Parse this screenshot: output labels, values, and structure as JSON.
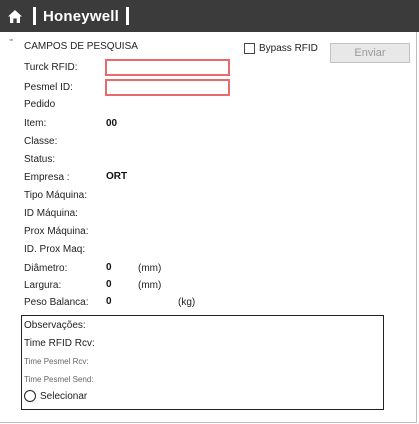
{
  "header": {
    "brand": "Honeywell",
    "home_icon": "home-icon"
  },
  "form": {
    "section_title": "CAMPOS DE PESQUISA",
    "bypass_label": "Bypass RFID",
    "bypass_checked": false,
    "send_label": "Enviar",
    "turck_label": "Turck RFID:",
    "turck_value": "",
    "pesmel_label": "Pesmel ID:",
    "pesmel_value": "",
    "pedido_label": "Pedido",
    "item_label": "Item:",
    "item_value": "00",
    "classe_label": "Classe:",
    "status_label": "Status:",
    "empresa_label": "Empresa :",
    "empresa_value": "ORT",
    "tipo_label": "Tipo Máquina:",
    "id_maquina_label": "ID Máquina:",
    "prox_maquina_label": "Prox Máquina:",
    "id_prox_label": "ID. Prox Maq:",
    "diametro_label": "Diâmetro:",
    "diametro_value": "0",
    "diametro_unit": "(mm)",
    "largura_label": "Largura:",
    "largura_value": "0",
    "largura_unit": "(mm)",
    "peso_label": "Peso Balanca:",
    "peso_value": "0",
    "peso_unit": "(kg)"
  },
  "observations": {
    "obs_label": "Observações:",
    "time_rfid_label": "Time RFID Rcv:",
    "time_pesmel_rcv_label": "Time Pesmel Rcv:",
    "time_pesmel_send_label": "Time Pesmel Send:",
    "select_label": "Selecionar"
  },
  "colors": {
    "header_bg": "#3b3b3b",
    "input_border": "#e86a6a",
    "button_bg": "#e8e8e8"
  }
}
